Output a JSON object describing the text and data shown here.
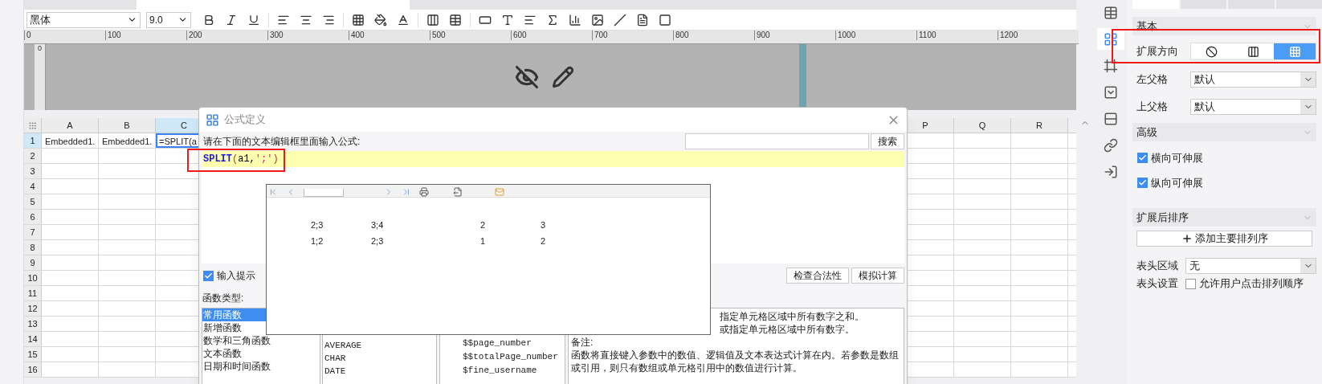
{
  "toolbar": {
    "font": "黑体",
    "font_size": "9.0"
  },
  "ruler": {
    "ticks": [
      "0",
      "100",
      "200",
      "300",
      "400",
      "500",
      "600",
      "700",
      "800",
      "900",
      "1000",
      "1100",
      "1200"
    ],
    "vertical_tick": "0"
  },
  "sheet": {
    "columns_left": [
      {
        "label": "A",
        "selected": false
      },
      {
        "label": "B",
        "selected": false
      },
      {
        "label": "C",
        "selected": true
      }
    ],
    "columns_right": [
      {
        "label": "P",
        "selected": false
      },
      {
        "label": "Q",
        "selected": false
      },
      {
        "label": "R",
        "selected": false
      }
    ],
    "rows": [
      {
        "label": "1",
        "selected": true
      },
      {
        "label": "2",
        "selected": false
      },
      {
        "label": "3",
        "selected": false
      },
      {
        "label": "4",
        "selected": false
      },
      {
        "label": "5",
        "selected": false
      },
      {
        "label": "6",
        "selected": false
      },
      {
        "label": "7",
        "selected": false
      },
      {
        "label": "8",
        "selected": false
      },
      {
        "label": "9",
        "selected": false
      },
      {
        "label": "10",
        "selected": false
      },
      {
        "label": "11",
        "selected": false
      },
      {
        "label": "12",
        "selected": false
      },
      {
        "label": "13",
        "selected": false
      },
      {
        "label": "14",
        "selected": false
      },
      {
        "label": "15",
        "selected": false
      },
      {
        "label": "16",
        "selected": false
      }
    ],
    "row_1_cells": [
      {
        "text": "Embedded1.",
        "selected": false
      },
      {
        "text": "Embedded1.",
        "selected": false
      },
      {
        "text": "=SPLIT(a",
        "selected": true
      }
    ]
  },
  "dialog": {
    "title": "公式定义",
    "prompt": "请在下面的文本编辑框里面输入公式:",
    "search_button": "搜索",
    "formula": [
      {
        "text": "SPLIT",
        "kind": "function"
      },
      {
        "text": "(",
        "kind": "paren"
      },
      {
        "text": "a1,",
        "kind": "plain"
      },
      {
        "text": "';'",
        "kind": "string"
      },
      {
        "text": ")",
        "kind": "paren"
      }
    ],
    "input_hint": {
      "label": "输入提示",
      "checked": true
    },
    "buttons": [
      "检查合法性",
      "模拟计算"
    ],
    "function_type_label": "函数类型:",
    "categories": [
      {
        "label": "常用函数",
        "selected": true
      },
      {
        "label": "新增函数",
        "selected": false
      },
      {
        "label": "数学和三角函数",
        "selected": false
      },
      {
        "label": "文本函数",
        "selected": false
      },
      {
        "label": "日期和时间函数",
        "selected": false
      }
    ],
    "functions": [
      "AVERAGE",
      "CHAR",
      "DATE"
    ],
    "variables": [
      "$$page_number",
      "$$totalPage_number",
      "$fine_username"
    ],
    "description": {
      "lines_partial": [
        "指定单元格区域中所有数字之和。",
        "或指定单元格区域中所有数字。"
      ],
      "note_label": "备注:",
      "note": "函数将直接键入参数中的数值、逻辑值及文本表达式计算在内。若参数是数组或引用，则只有数组或单元格引用中的数值进行计算。"
    }
  },
  "preview": {
    "rows": [
      [
        "2;3",
        "3;4",
        "2",
        "3"
      ],
      [
        "1;2",
        "2;3",
        "1",
        "2"
      ]
    ]
  },
  "panel": {
    "tabs": [
      {
        "selected": true
      },
      {
        "selected": false
      },
      {
        "selected": false
      },
      {
        "selected": false
      }
    ],
    "sections": [
      {
        "title": "基本",
        "kind": "basic",
        "expand_label": "扩展方向",
        "expand_options": [
          {
            "kind": "none",
            "selected": false
          },
          {
            "kind": "vertical",
            "selected": false
          },
          {
            "kind": "horizontal",
            "selected": true
          }
        ],
        "selects": [
          {
            "label": "左父格",
            "value": "默认"
          },
          {
            "label": "上父格",
            "value": "默认"
          }
        ]
      },
      {
        "title": "高级",
        "kind": "advanced",
        "checks": [
          {
            "label": "横向可伸展",
            "checked": true
          },
          {
            "label": "纵向可伸展",
            "checked": true
          }
        ]
      },
      {
        "title": "扩展后排序",
        "kind": "sort",
        "add_button": "添加主要排列序",
        "header_area": {
          "label": "表头区域",
          "value": "无"
        },
        "header_setting": {
          "label": "表头设置",
          "option": "允许用户点击排列顺序",
          "checked": false
        }
      }
    ]
  }
}
